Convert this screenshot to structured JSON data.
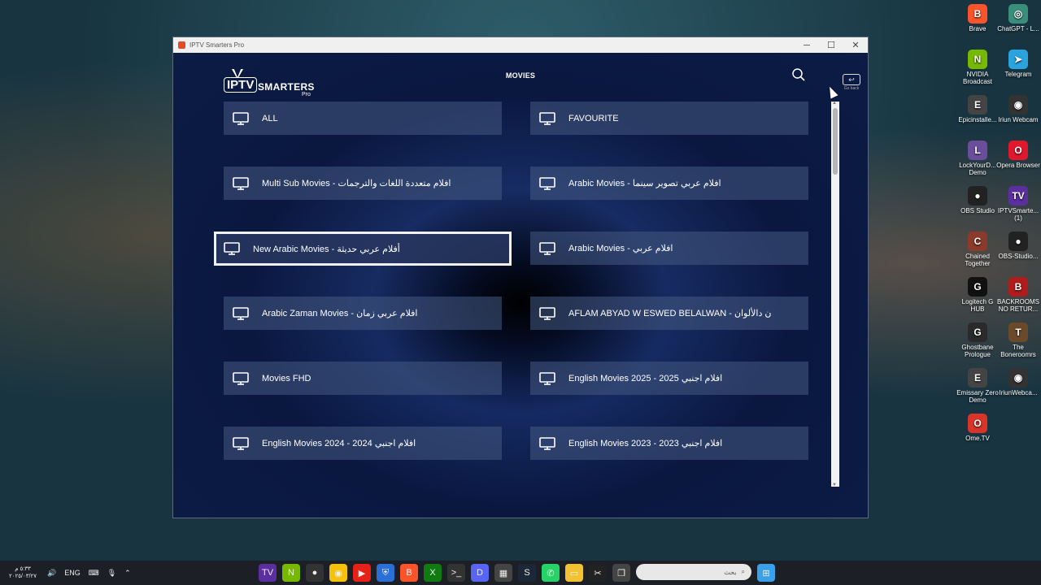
{
  "window": {
    "title": "IPTV Smarters Pro",
    "controls": {
      "minimize": "─",
      "maximize": "☐",
      "close": "✕"
    }
  },
  "app": {
    "logo": {
      "iptv": "IPTV",
      "smarters": "SMARTERS",
      "pro": "Pro"
    },
    "page_title": "MOVIES",
    "goback_label": "Go back"
  },
  "categories": [
    {
      "label": "ALL"
    },
    {
      "label": "FAVOURITE"
    },
    {
      "label": "Multi Sub Movies - افلام متعددة اللغات والترجمات"
    },
    {
      "label": "Arabic Movies - افلام عربي تصوير سينما"
    },
    {
      "label": "New Arabic Movies - أفلام عربي حديثة",
      "focused": true
    },
    {
      "label": "Arabic Movies - افلام عربي"
    },
    {
      "label": "Arabic Zaman Movies - افلام عربي زمان"
    },
    {
      "label": "AFLAM ABYAD W ESWED BELALWAN - ن دالألوان"
    },
    {
      "label": "Movies FHD"
    },
    {
      "label": "English Movies 2025 - 2025 افلام اجنبي"
    },
    {
      "label": "English Movies 2024 - 2024 افلام اجنبي"
    },
    {
      "label": "English Movies 2023 - 2023 افلام اجنبي"
    }
  ],
  "desktop_icons": [
    {
      "label": "Brave",
      "color": "#fb542b",
      "glyph": "B"
    },
    {
      "label": "ChatGPT - L...",
      "color": "#3a8f7a",
      "glyph": "◎"
    },
    {
      "label": "NVIDIA Broadcast",
      "color": "#76b900",
      "glyph": "N"
    },
    {
      "label": "Telegram",
      "color": "#2aa3df",
      "glyph": "➤"
    },
    {
      "label": "Epicinstalle...",
      "color": "#444",
      "glyph": "E"
    },
    {
      "label": "Iriun Webcam",
      "color": "#333",
      "glyph": "◉"
    },
    {
      "label": "LockYourD... Demo",
      "color": "#6b4e9b",
      "glyph": "L"
    },
    {
      "label": "Opera Browser",
      "color": "#e0182d",
      "glyph": "O"
    },
    {
      "label": "OBS Studio",
      "color": "#222",
      "glyph": "●"
    },
    {
      "label": "IPTVSmarte... (1)",
      "color": "#5b2fa0",
      "glyph": "TV"
    },
    {
      "label": "Chained Together",
      "color": "#8a3b2a",
      "glyph": "C"
    },
    {
      "label": "OBS-Studio...",
      "color": "#222",
      "glyph": "●"
    },
    {
      "label": "Logitech G HUB",
      "color": "#111",
      "glyph": "G"
    },
    {
      "label": "BACKROOMS NO RETUR...",
      "color": "#b01c1c",
      "glyph": "B"
    },
    {
      "label": "Ghostbane Prologue",
      "color": "#2a2a2a",
      "glyph": "G"
    },
    {
      "label": "The Boneroomrs",
      "color": "#6a4a2a",
      "glyph": "T"
    },
    {
      "label": "Emissary Zero Demo",
      "color": "#444",
      "glyph": "E"
    },
    {
      "label": "IriunWebca...",
      "color": "#333",
      "glyph": "◉"
    },
    {
      "label": "Ome.TV",
      "color": "#d8342a",
      "glyph": "O"
    }
  ],
  "taskbar": {
    "time": "٥:٣٣ م",
    "date": "٢٠٢٥/٠٣/٢٧",
    "lang": "ENG",
    "search_placeholder": "بحث",
    "apps": [
      {
        "name": "iptv-app",
        "color": "#5b2fa0",
        "glyph": "TV"
      },
      {
        "name": "nvidia",
        "color": "#76b900",
        "glyph": "N"
      },
      {
        "name": "obs",
        "color": "#333",
        "glyph": "●"
      },
      {
        "name": "chrome",
        "color": "#f4c20d",
        "glyph": "◉"
      },
      {
        "name": "youtube",
        "color": "#e62117",
        "glyph": "▶"
      },
      {
        "name": "defender",
        "color": "#2a6fd6",
        "glyph": "⛨"
      },
      {
        "name": "brave",
        "color": "#fb542b",
        "glyph": "B"
      },
      {
        "name": "xbox",
        "color": "#107c10",
        "glyph": "X"
      },
      {
        "name": "terminal",
        "color": "#333",
        "glyph": ">_"
      },
      {
        "name": "discord",
        "color": "#5865f2",
        "glyph": "D"
      },
      {
        "name": "store",
        "color": "#444",
        "glyph": "▦"
      },
      {
        "name": "steam",
        "color": "#1b2838",
        "glyph": "S"
      },
      {
        "name": "whatsapp",
        "color": "#25d366",
        "glyph": "✆"
      },
      {
        "name": "explorer",
        "color": "#f1c232",
        "glyph": "▭"
      },
      {
        "name": "capcut",
        "color": "#222",
        "glyph": "✂"
      },
      {
        "name": "taskview",
        "color": "#444",
        "glyph": "❐"
      }
    ]
  }
}
